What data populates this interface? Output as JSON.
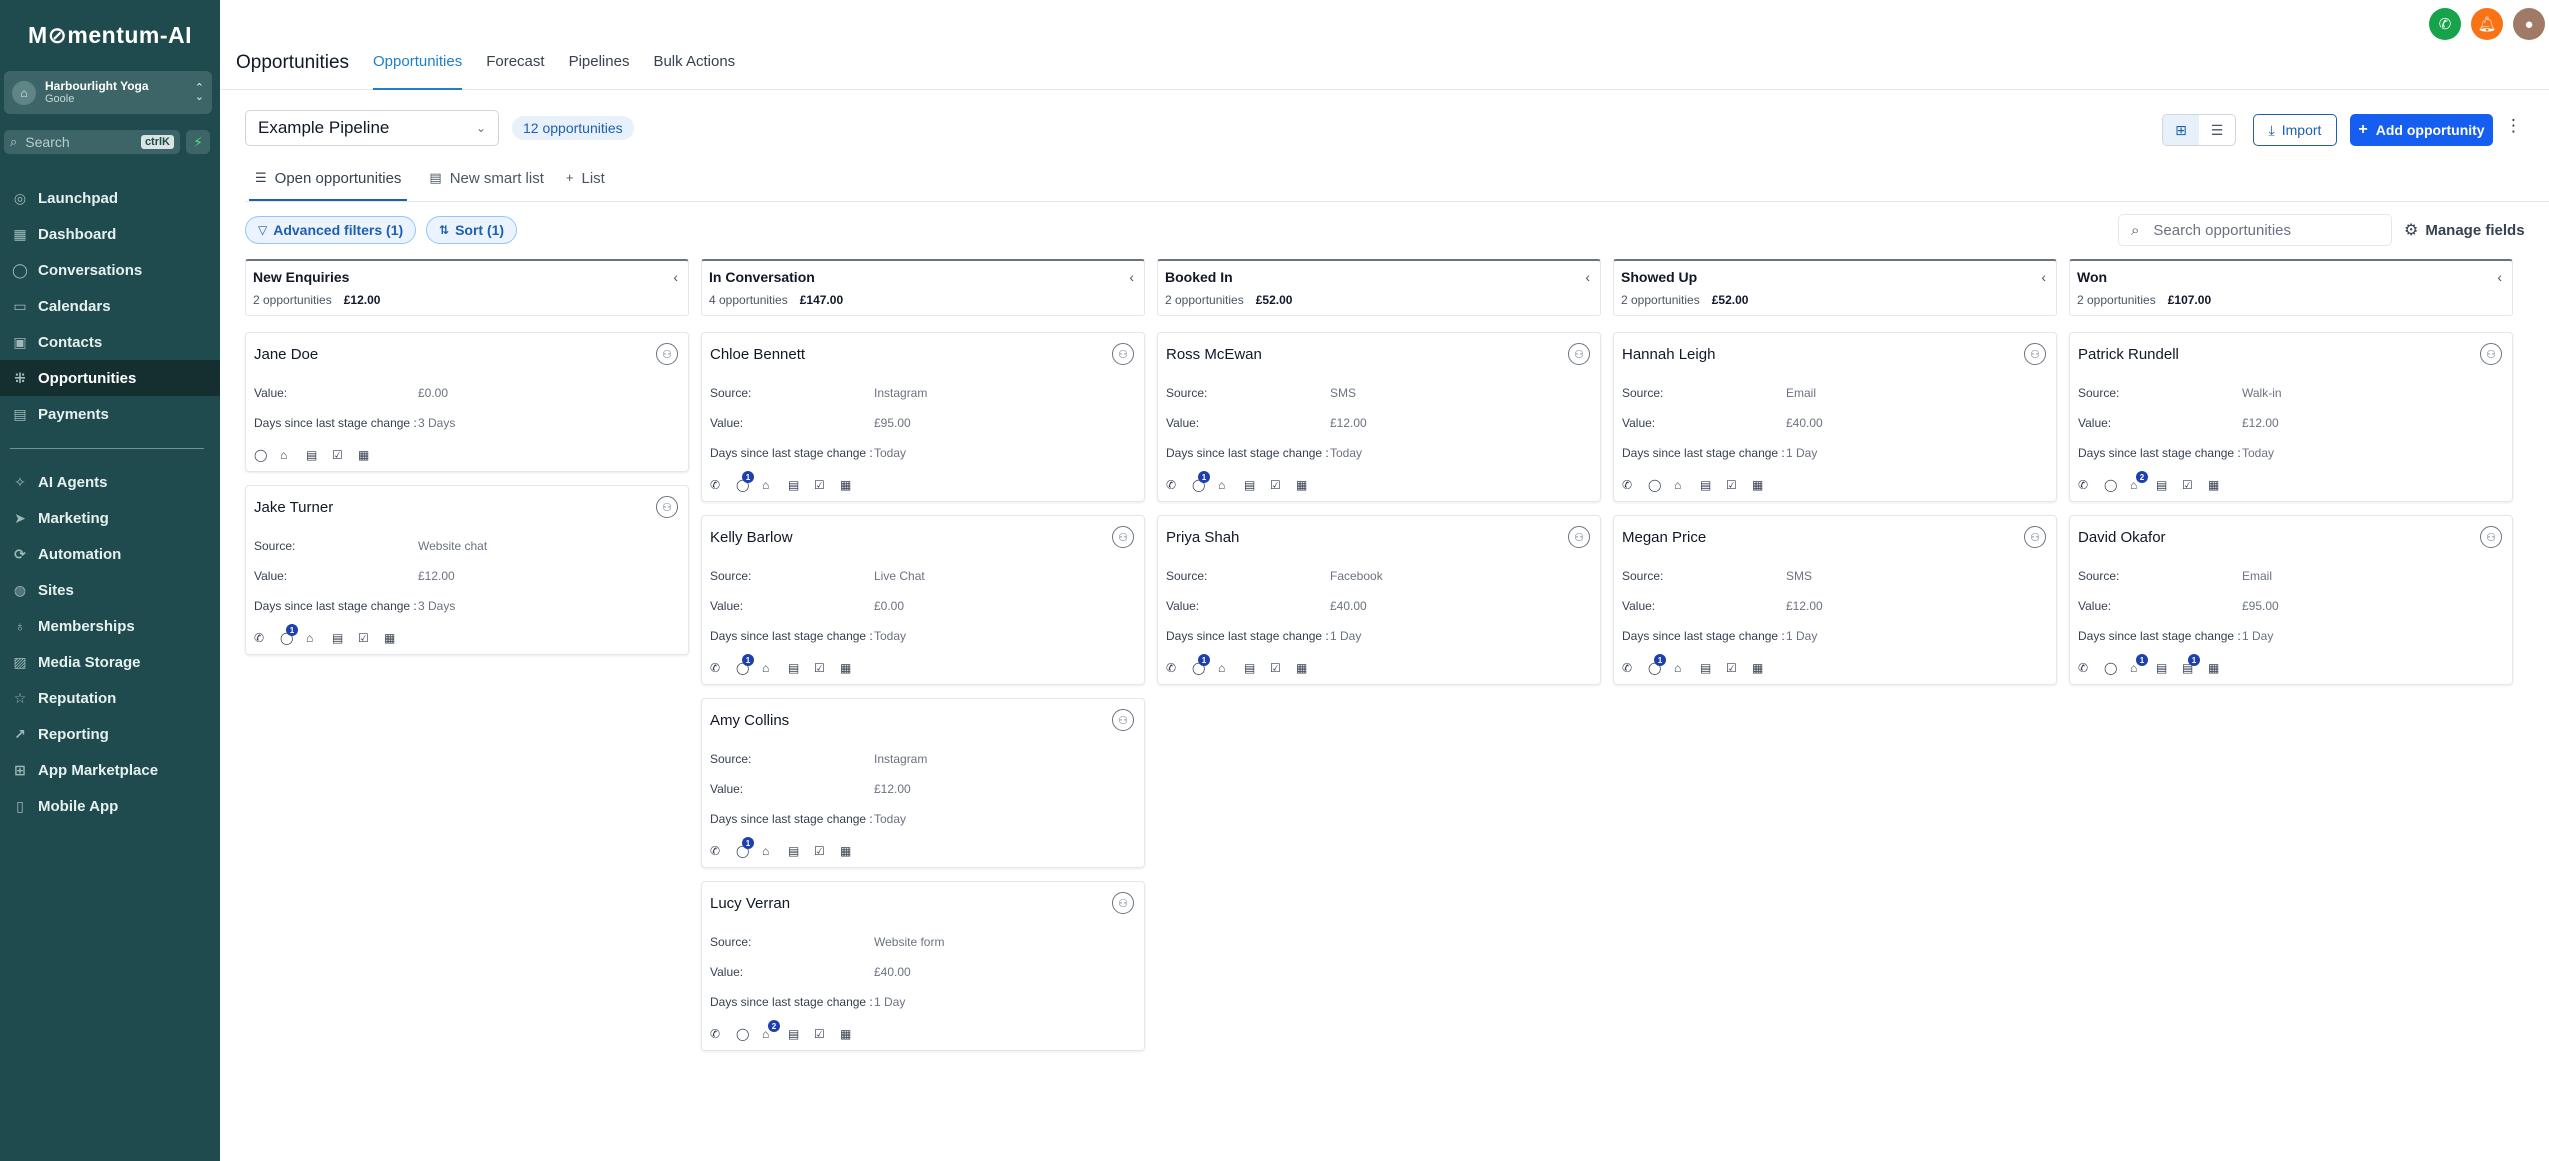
{
  "app": {
    "logo": "M⊘mentum-AI"
  },
  "account": {
    "name": "Harbourlight Yoga",
    "sub": "Goole"
  },
  "sidebar_search": {
    "placeholder": "Search",
    "shortcut": "ctrlK"
  },
  "nav": [
    {
      "label": "Launchpad",
      "icon": "rocket-icon"
    },
    {
      "label": "Dashboard",
      "icon": "dashboard-icon"
    },
    {
      "label": "Conversations",
      "icon": "chat-icon"
    },
    {
      "label": "Calendars",
      "icon": "calendar-icon"
    },
    {
      "label": "Contacts",
      "icon": "contacts-icon"
    },
    {
      "label": "Opportunities",
      "icon": "opportunities-icon",
      "active": true
    },
    {
      "label": "Payments",
      "icon": "payments-icon"
    },
    {
      "label": "AI Agents",
      "icon": "ai-agents-icon"
    },
    {
      "label": "Marketing",
      "icon": "marketing-icon"
    },
    {
      "label": "Automation",
      "icon": "automation-icon"
    },
    {
      "label": "Sites",
      "icon": "sites-icon"
    },
    {
      "label": "Memberships",
      "icon": "memberships-icon"
    },
    {
      "label": "Media Storage",
      "icon": "media-icon"
    },
    {
      "label": "Reputation",
      "icon": "star-icon"
    },
    {
      "label": "Reporting",
      "icon": "reporting-icon"
    },
    {
      "label": "App Marketplace",
      "icon": "marketplace-icon"
    },
    {
      "label": "Mobile App",
      "icon": "mobile-icon"
    }
  ],
  "header": {
    "title": "Opportunities",
    "tabs": [
      "Opportunities",
      "Forecast",
      "Pipelines",
      "Bulk Actions"
    ]
  },
  "toolbar": {
    "pipeline": "Example Pipeline",
    "count": "12 opportunities",
    "import": "Import",
    "add": "Add opportunity"
  },
  "subtabs": [
    "Open opportunities",
    "New smart list",
    "List"
  ],
  "filters": {
    "advanced": "Advanced filters (1)",
    "sort": "Sort (1)"
  },
  "search": {
    "placeholder": "Search opportunities"
  },
  "manage_fields": "Manage fields",
  "labels": {
    "source": "Source:",
    "value": "Value:",
    "days": "Days since last stage change :"
  },
  "columns": [
    {
      "title": "New Enquiries",
      "count": "2 opportunities",
      "total": "£12.00",
      "cards": [
        {
          "name": "Jane Doe",
          "value": "£0.00",
          "days": "3 Days",
          "icons": [
            "chat",
            "tag",
            "doc",
            "check",
            "cal"
          ]
        },
        {
          "name": "Jake Turner",
          "source": "Website chat",
          "value": "£12.00",
          "days": "3 Days",
          "icons": [
            "phone",
            "chat:1",
            "tag",
            "doc",
            "check",
            "cal"
          ]
        }
      ]
    },
    {
      "title": "In Conversation",
      "count": "4 opportunities",
      "total": "£147.00",
      "cards": [
        {
          "name": "Chloe Bennett",
          "source": "Instagram",
          "value": "£95.00",
          "days": "Today",
          "icons": [
            "phone",
            "chat:1",
            "tag",
            "doc",
            "check",
            "cal"
          ]
        },
        {
          "name": "Kelly Barlow",
          "source": "Live Chat",
          "value": "£0.00",
          "days": "Today",
          "icons": [
            "phone",
            "chat:1",
            "tag",
            "doc",
            "check",
            "cal"
          ]
        },
        {
          "name": "Amy Collins",
          "source": "Instagram",
          "value": "£12.00",
          "days": "Today",
          "icons": [
            "phone",
            "chat:1",
            "tag",
            "doc",
            "check",
            "cal"
          ]
        },
        {
          "name": "Lucy Verran",
          "source": "Website form",
          "value": "£40.00",
          "days": "1 Day",
          "icons": [
            "phone",
            "chat",
            "tag:2",
            "doc",
            "check",
            "cal"
          ]
        }
      ]
    },
    {
      "title": "Booked In",
      "count": "2 opportunities",
      "total": "£52.00",
      "cards": [
        {
          "name": "Ross McEwan",
          "source": "SMS",
          "value": "£12.00",
          "days": "Today",
          "icons": [
            "phone",
            "chat:1",
            "tag",
            "doc",
            "check",
            "cal"
          ]
        },
        {
          "name": "Priya Shah",
          "source": "Facebook",
          "value": "£40.00",
          "days": "1 Day",
          "icons": [
            "phone",
            "chat:1",
            "tag",
            "doc",
            "check",
            "cal"
          ]
        }
      ]
    },
    {
      "title": "Showed Up",
      "count": "2 opportunities",
      "total": "£52.00",
      "cards": [
        {
          "name": "Hannah Leigh",
          "source": "Email",
          "value": "£40.00",
          "days": "1 Day",
          "icons": [
            "phone",
            "chat",
            "tag",
            "doc",
            "check",
            "cal"
          ]
        },
        {
          "name": "Megan Price",
          "source": "SMS",
          "value": "£12.00",
          "days": "1 Day",
          "icons": [
            "phone",
            "chat:1",
            "tag",
            "doc",
            "check",
            "cal"
          ]
        }
      ]
    },
    {
      "title": "Won",
      "count": "2 opportunities",
      "total": "£107.00",
      "cards": [
        {
          "name": "Patrick Rundell",
          "source": "Walk-in",
          "value": "£12.00",
          "days": "Today",
          "icons": [
            "phone",
            "chat",
            "tag:2",
            "doc",
            "check",
            "cal"
          ]
        },
        {
          "name": "David Okafor",
          "source": "Email",
          "value": "£95.00",
          "days": "1 Day",
          "icons": [
            "phone",
            "chat",
            "tag:1",
            "doc",
            "doc:1",
            "cal"
          ]
        }
      ]
    }
  ]
}
